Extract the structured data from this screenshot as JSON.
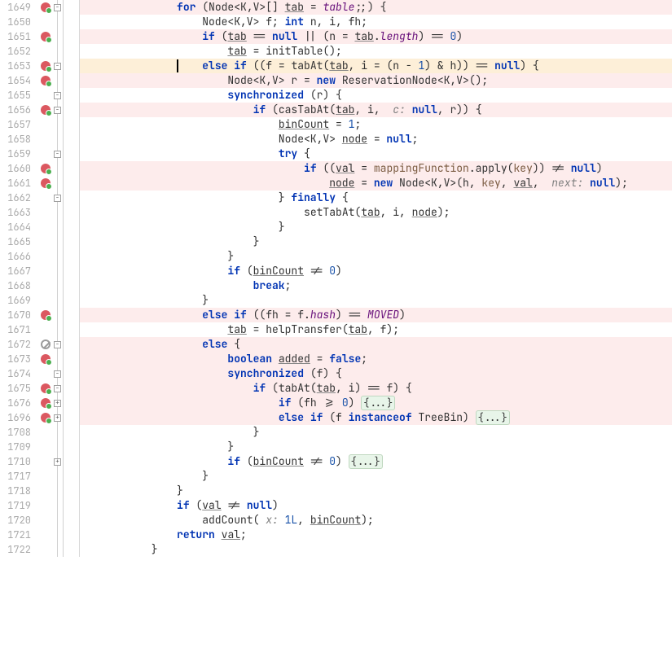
{
  "rows": [
    {
      "n": 1649,
      "hl": true,
      "bp": true,
      "fold": "-",
      "tokens": [
        {
          "t": "               "
        },
        {
          "t": "for",
          "c": "kw"
        },
        {
          "t": " (Node<K,V>[] "
        },
        {
          "t": "tab",
          "c": "ul"
        },
        {
          "t": " = "
        },
        {
          "t": "table",
          "c": "fld"
        },
        {
          "t": ";;) {"
        }
      ]
    },
    {
      "n": 1650,
      "tokens": [
        {
          "t": "                   Node<K,V> f; "
        },
        {
          "t": "int",
          "c": "kw"
        },
        {
          "t": " n, i, fh;"
        }
      ]
    },
    {
      "n": 1651,
      "hl": true,
      "bp": true,
      "tokens": [
        {
          "t": "                   "
        },
        {
          "t": "if",
          "c": "kw"
        },
        {
          "t": " ("
        },
        {
          "t": "tab",
          "c": "ul"
        },
        {
          "t": " == "
        },
        {
          "t": "null",
          "c": "kw"
        },
        {
          "t": " || (n = "
        },
        {
          "t": "tab",
          "c": "ul"
        },
        {
          "t": "."
        },
        {
          "t": "length",
          "c": "fld"
        },
        {
          "t": ") == "
        },
        {
          "t": "0",
          "c": "num2"
        },
        {
          "t": ")"
        }
      ]
    },
    {
      "n": 1652,
      "tokens": [
        {
          "t": "                       "
        },
        {
          "t": "tab",
          "c": "ul"
        },
        {
          "t": " = initTable();"
        }
      ]
    },
    {
      "n": 1653,
      "hlc": true,
      "bp": true,
      "fold": "-",
      "caret": true,
      "tokens": [
        {
          "t": "                   "
        },
        {
          "t": "else if",
          "c": "kw"
        },
        {
          "t": " ((f = "
        },
        {
          "t": "tabAt",
          "c": ""
        },
        {
          "t": "("
        },
        {
          "t": "tab",
          "c": "ul"
        },
        {
          "t": ", i = (n - "
        },
        {
          "t": "1",
          "c": "num2"
        },
        {
          "t": ") & h)) == "
        },
        {
          "t": "null",
          "c": "kw"
        },
        {
          "t": ") {"
        }
      ]
    },
    {
      "n": 1654,
      "hl": true,
      "bp": true,
      "tokens": [
        {
          "t": "                       Node<K,V> r = "
        },
        {
          "t": "new",
          "c": "kw"
        },
        {
          "t": " ReservationNode<K,V>();"
        }
      ]
    },
    {
      "n": 1655,
      "fold": "-",
      "tokens": [
        {
          "t": "                       "
        },
        {
          "t": "synchronized",
          "c": "kw"
        },
        {
          "t": " (r) {"
        }
      ]
    },
    {
      "n": 1656,
      "hl": true,
      "bp": true,
      "fold": "-",
      "tokens": [
        {
          "t": "                           "
        },
        {
          "t": "if",
          "c": "kw"
        },
        {
          "t": " ("
        },
        {
          "t": "casTabAt",
          "c": ""
        },
        {
          "t": "("
        },
        {
          "t": "tab",
          "c": "ul"
        },
        {
          "t": ", i,  "
        },
        {
          "t": "c:",
          "c": "cm"
        },
        {
          "t": " "
        },
        {
          "t": "null",
          "c": "kw"
        },
        {
          "t": ", r)) {"
        }
      ]
    },
    {
      "n": 1657,
      "tokens": [
        {
          "t": "                               "
        },
        {
          "t": "binCount",
          "c": "ul"
        },
        {
          "t": " = "
        },
        {
          "t": "1",
          "c": "num2"
        },
        {
          "t": ";"
        }
      ]
    },
    {
      "n": 1658,
      "tokens": [
        {
          "t": "                               Node<K,V> "
        },
        {
          "t": "node",
          "c": "ul"
        },
        {
          "t": " = "
        },
        {
          "t": "null",
          "c": "kw"
        },
        {
          "t": ";"
        }
      ]
    },
    {
      "n": 1659,
      "fold": "-",
      "tokens": [
        {
          "t": "                               "
        },
        {
          "t": "try",
          "c": "kw"
        },
        {
          "t": " {"
        }
      ]
    },
    {
      "n": 1660,
      "hl": true,
      "bp": true,
      "tokens": [
        {
          "t": "                                   "
        },
        {
          "t": "if",
          "c": "kw"
        },
        {
          "t": " (("
        },
        {
          "t": "val",
          "c": "ul"
        },
        {
          "t": " = "
        },
        {
          "t": "mappingFunction",
          "c": "prm"
        },
        {
          "t": ".apply("
        },
        {
          "t": "key",
          "c": "prm"
        },
        {
          "t": ")) != "
        },
        {
          "t": "null",
          "c": "kw"
        },
        {
          "t": ")"
        }
      ]
    },
    {
      "n": 1661,
      "hl": true,
      "bp": true,
      "tokens": [
        {
          "t": "                                       "
        },
        {
          "t": "node",
          "c": "ul"
        },
        {
          "t": " = "
        },
        {
          "t": "new",
          "c": "kw"
        },
        {
          "t": " Node<K,V>(h, "
        },
        {
          "t": "key",
          "c": "prm"
        },
        {
          "t": ", "
        },
        {
          "t": "val",
          "c": "ul"
        },
        {
          "t": ",  "
        },
        {
          "t": "next:",
          "c": "cm"
        },
        {
          "t": " "
        },
        {
          "t": "null",
          "c": "kw"
        },
        {
          "t": ");"
        }
      ]
    },
    {
      "n": 1662,
      "fold": "-",
      "tokens": [
        {
          "t": "                               } "
        },
        {
          "t": "finally",
          "c": "kw"
        },
        {
          "t": " {"
        }
      ]
    },
    {
      "n": 1663,
      "tokens": [
        {
          "t": "                                   "
        },
        {
          "t": "setTabAt",
          "c": ""
        },
        {
          "t": "("
        },
        {
          "t": "tab",
          "c": "ul"
        },
        {
          "t": ", i, "
        },
        {
          "t": "node",
          "c": "ul"
        },
        {
          "t": ");"
        }
      ]
    },
    {
      "n": 1664,
      "tokens": [
        {
          "t": "                               }"
        }
      ]
    },
    {
      "n": 1665,
      "tokens": [
        {
          "t": "                           }"
        }
      ]
    },
    {
      "n": 1666,
      "tokens": [
        {
          "t": "                       }"
        }
      ]
    },
    {
      "n": 1667,
      "tokens": [
        {
          "t": "                       "
        },
        {
          "t": "if",
          "c": "kw"
        },
        {
          "t": " ("
        },
        {
          "t": "binCount",
          "c": "ul"
        },
        {
          "t": " != "
        },
        {
          "t": "0",
          "c": "num2"
        },
        {
          "t": ")"
        }
      ]
    },
    {
      "n": 1668,
      "tokens": [
        {
          "t": "                           "
        },
        {
          "t": "break",
          "c": "kw"
        },
        {
          "t": ";"
        }
      ]
    },
    {
      "n": 1669,
      "tokens": [
        {
          "t": "                   }"
        }
      ]
    },
    {
      "n": 1670,
      "hl": true,
      "bp": true,
      "tokens": [
        {
          "t": "                   "
        },
        {
          "t": "else if",
          "c": "kw"
        },
        {
          "t": " ((fh = f."
        },
        {
          "t": "hash",
          "c": "fld"
        },
        {
          "t": ") == "
        },
        {
          "t": "MOVED",
          "c": "fld"
        },
        {
          "t": ")"
        }
      ]
    },
    {
      "n": 1671,
      "tokens": [
        {
          "t": "                       "
        },
        {
          "t": "tab",
          "c": "ul"
        },
        {
          "t": " = helpTransfer("
        },
        {
          "t": "tab",
          "c": "ul"
        },
        {
          "t": ", f);"
        }
      ]
    },
    {
      "n": 1672,
      "hl": true,
      "nb": true,
      "fold": "-",
      "tokens": [
        {
          "t": "                   "
        },
        {
          "t": "else",
          "c": "kw"
        },
        {
          "t": " {"
        }
      ]
    },
    {
      "n": 1673,
      "hl": true,
      "bp": true,
      "tokens": [
        {
          "t": "                       "
        },
        {
          "t": "boolean",
          "c": "kw"
        },
        {
          "t": " "
        },
        {
          "t": "added",
          "c": "ul"
        },
        {
          "t": " = "
        },
        {
          "t": "false",
          "c": "kw"
        },
        {
          "t": ";"
        }
      ]
    },
    {
      "n": 1674,
      "hl": true,
      "fold": "-",
      "tokens": [
        {
          "t": "                       "
        },
        {
          "t": "synchronized",
          "c": "kw"
        },
        {
          "t": " (f) {"
        }
      ]
    },
    {
      "n": 1675,
      "hl": true,
      "bp": true,
      "fold": "-",
      "tokens": [
        {
          "t": "                           "
        },
        {
          "t": "if",
          "c": "kw"
        },
        {
          "t": " ("
        },
        {
          "t": "tabAt",
          "c": ""
        },
        {
          "t": "("
        },
        {
          "t": "tab",
          "c": "ul"
        },
        {
          "t": ", i) == f) {"
        }
      ]
    },
    {
      "n": 1676,
      "hl": true,
      "bp": true,
      "fold": "+",
      "tokens": [
        {
          "t": "                               "
        },
        {
          "t": "if",
          "c": "kw"
        },
        {
          "t": " (fh >= "
        },
        {
          "t": "0",
          "c": "num2"
        },
        {
          "t": ") "
        },
        {
          "t": "{...}",
          "c": "foldspan"
        }
      ]
    },
    {
      "n": 1696,
      "hl": true,
      "bp": true,
      "fold": "+",
      "tokens": [
        {
          "t": "                               "
        },
        {
          "t": "else if",
          "c": "kw"
        },
        {
          "t": " (f "
        },
        {
          "t": "instanceof",
          "c": "kw"
        },
        {
          "t": " TreeBin) "
        },
        {
          "t": "{...}",
          "c": "foldspan"
        }
      ]
    },
    {
      "n": 1708,
      "tokens": [
        {
          "t": "                           }"
        }
      ]
    },
    {
      "n": 1709,
      "tokens": [
        {
          "t": "                       }"
        }
      ]
    },
    {
      "n": 1710,
      "fold": "+",
      "tokens": [
        {
          "t": "                       "
        },
        {
          "t": "if",
          "c": "kw"
        },
        {
          "t": " ("
        },
        {
          "t": "binCount",
          "c": "ul"
        },
        {
          "t": " != "
        },
        {
          "t": "0",
          "c": "num2"
        },
        {
          "t": ") "
        },
        {
          "t": "{...}",
          "c": "foldspan"
        }
      ]
    },
    {
      "n": 1717,
      "tokens": [
        {
          "t": "                   }"
        }
      ]
    },
    {
      "n": 1718,
      "tokens": [
        {
          "t": "               }"
        }
      ]
    },
    {
      "n": 1719,
      "tokens": [
        {
          "t": "               "
        },
        {
          "t": "if",
          "c": "kw"
        },
        {
          "t": " ("
        },
        {
          "t": "val",
          "c": "ul"
        },
        {
          "t": " != "
        },
        {
          "t": "null",
          "c": "kw"
        },
        {
          "t": ")"
        }
      ]
    },
    {
      "n": 1720,
      "tokens": [
        {
          "t": "                   addCount( "
        },
        {
          "t": "x:",
          "c": "cm"
        },
        {
          "t": " "
        },
        {
          "t": "1L",
          "c": "num2"
        },
        {
          "t": ", "
        },
        {
          "t": "binCount",
          "c": "ul"
        },
        {
          "t": ");"
        }
      ]
    },
    {
      "n": 1721,
      "tokens": [
        {
          "t": "               "
        },
        {
          "t": "return",
          "c": "kw"
        },
        {
          "t": " "
        },
        {
          "t": "val",
          "c": "ul"
        },
        {
          "t": ";"
        }
      ]
    },
    {
      "n": 1722,
      "tokens": [
        {
          "t": "           }"
        }
      ]
    }
  ]
}
